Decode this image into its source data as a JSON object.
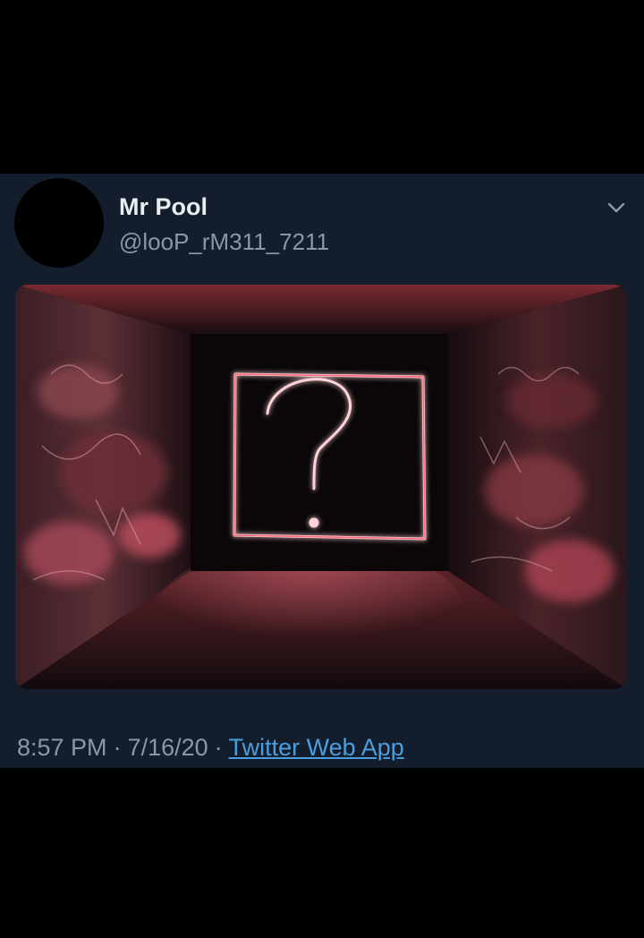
{
  "tweet": {
    "display_name": "Mr Pool",
    "handle": "@looP_rM311_7211",
    "more_icon": "chevron-down-icon",
    "image": {
      "subject": "neon question mark in a dark graffiti tunnel",
      "accent_color": "#ff5a6e"
    },
    "time": "8:57 PM",
    "date": "7/16/20",
    "separator": "·",
    "source": "Twitter Web App"
  },
  "colors": {
    "page_background": "#000000",
    "card_background": "#141d2b",
    "name_text": "#e9edf1",
    "muted_text": "#8a98a6",
    "link": "#4a9ee0"
  }
}
